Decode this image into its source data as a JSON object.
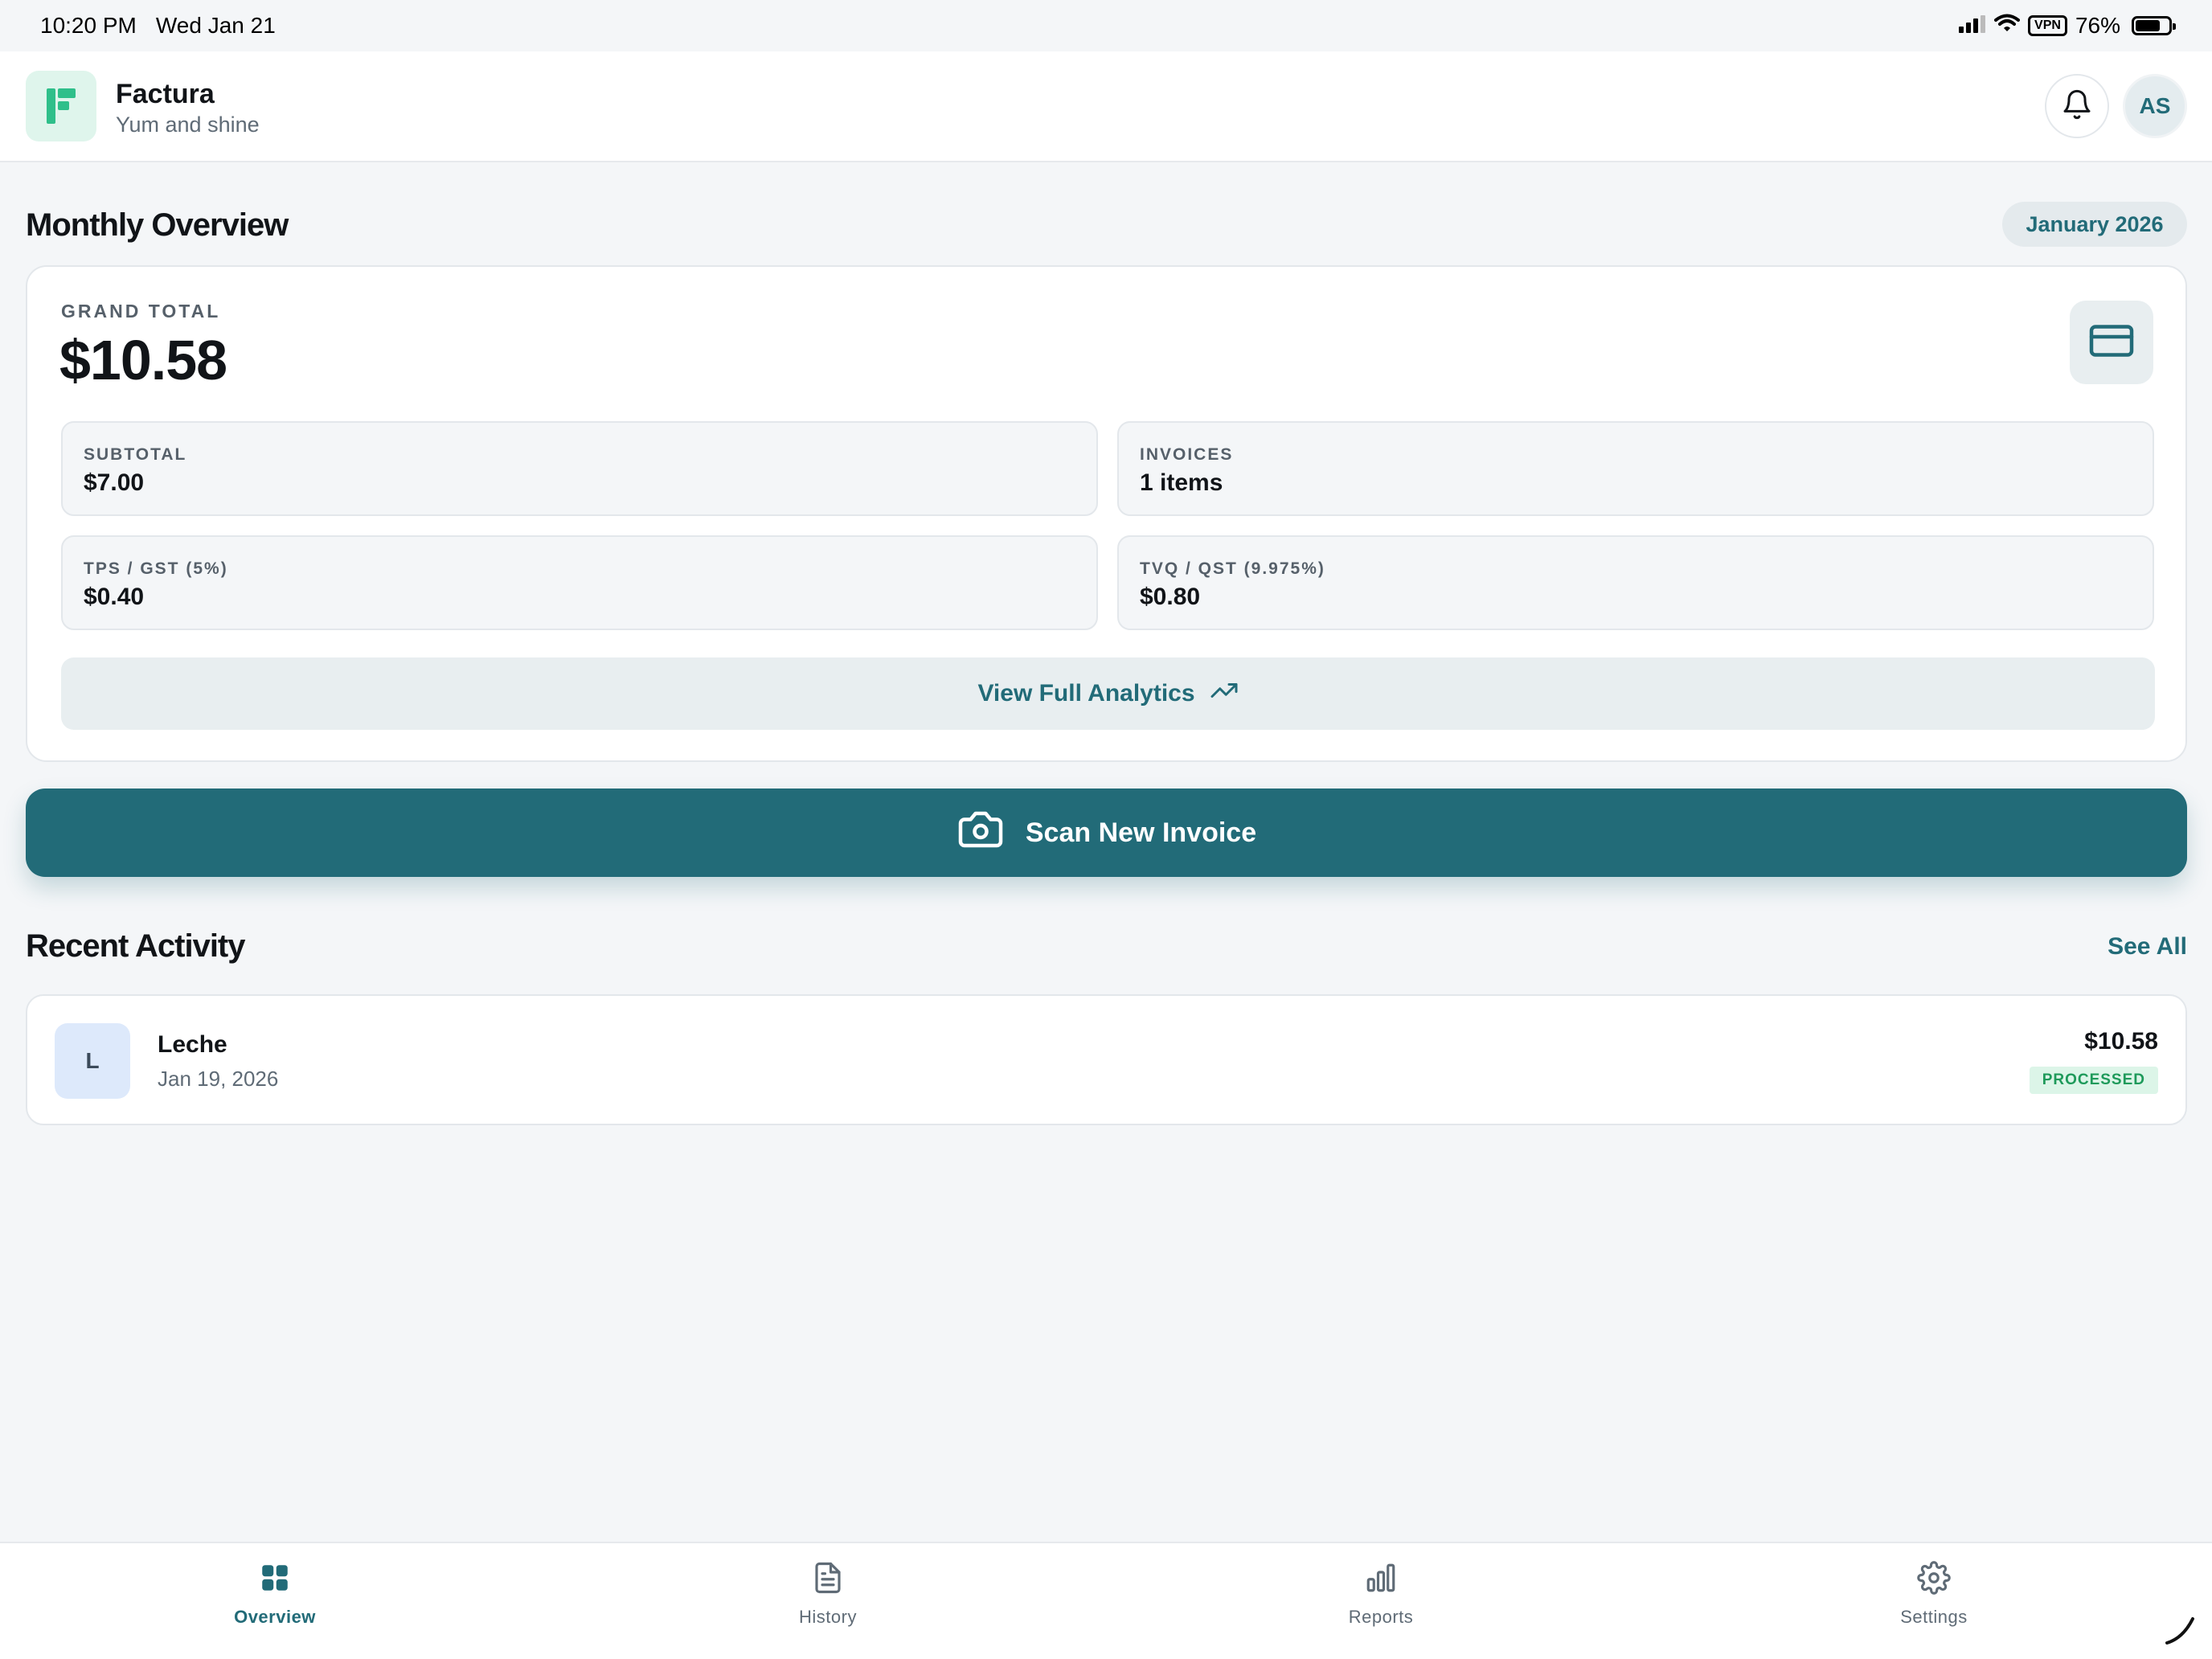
{
  "status_bar": {
    "time": "10:20 PM",
    "date": "Wed Jan 21",
    "vpn": "VPN",
    "battery": "76%"
  },
  "header": {
    "app_name": "Factura",
    "app_subtitle": "Yum and shine",
    "avatar_initials": "AS",
    "icons": [
      "factura-logo-icon",
      "bell-icon"
    ]
  },
  "overview": {
    "title": "Monthly Overview",
    "month": "January 2026",
    "grand_total_label": "GRAND TOTAL",
    "grand_total_value": "$10.58",
    "stats": [
      {
        "label": "SUBTOTAL",
        "value": "$7.00"
      },
      {
        "label": "INVOICES",
        "value": "1 items"
      },
      {
        "label": "TPS / GST (5%)",
        "value": "$0.40"
      },
      {
        "label": "TVQ / QST (9.975%)",
        "value": "$0.80"
      }
    ],
    "analytics_button": "View Full Analytics"
  },
  "scan_button": "Scan New Invoice",
  "recent": {
    "title": "Recent Activity",
    "see_all": "See All",
    "items": [
      {
        "initial": "L",
        "name": "Leche",
        "date": "Jan 19, 2026",
        "amount": "$10.58",
        "status": "PROCESSED"
      }
    ]
  },
  "tabs": [
    {
      "label": "Overview",
      "icon": "grid-icon",
      "active": true
    },
    {
      "label": "History",
      "icon": "document-icon",
      "active": false
    },
    {
      "label": "Reports",
      "icon": "bar-chart-icon",
      "active": false
    },
    {
      "label": "Settings",
      "icon": "gear-icon",
      "active": false
    }
  ],
  "colors": {
    "accent": "#226b78",
    "background": "#f4f6f8",
    "success": "#1e9a5a",
    "logo_green": "#2fbf8a"
  }
}
